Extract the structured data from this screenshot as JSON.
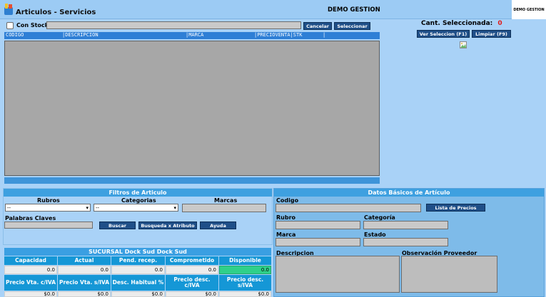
{
  "window": {
    "title": "Articulos - Servicios",
    "brand": "DEMO GESTION",
    "corner_logo_text": "DEMO GESTION"
  },
  "search": {
    "con_stock_label": "Con Stock",
    "cancel_label": "Cancelar",
    "select_label": "Seleccionar"
  },
  "selection": {
    "count_label": "Cant. Seleccionada:",
    "count_value": "0",
    "view_label": "Ver Seleccion (F1)",
    "clear_label": "Limpiar (F9)"
  },
  "table": {
    "columns": [
      "CODIGO",
      "|DESCRIPCION",
      "|MARCA",
      "|PRECIOVENTA|STK",
      "|"
    ]
  },
  "filters": {
    "title": "Filtros de Articulo",
    "rubros_label": "Rubros",
    "categorias_label": "Categorias",
    "marcas_label": "Marcas",
    "rubros_value": "--",
    "categorias_value": "--",
    "keywords_label": "Palabras Claves",
    "buscar_label": "Buscar",
    "atributo_label": "Busqueda x Atributo",
    "ayuda_label": "Ayuda"
  },
  "branch": {
    "title": "SUCURSAL Dock Sud Dock Sud",
    "row1_headers": [
      "Capacidad",
      "Actual",
      "Pend. recep.",
      "Comprometido",
      "Disponible"
    ],
    "row1_values": [
      "0.0",
      "0.0",
      "0.0",
      "0.0",
      "0.0"
    ],
    "row2_headers": [
      "Precio Vta. c/IVA",
      "Precio Vta. s/IVA",
      "Desc. Habitual %",
      "Precio desc. c/IVA",
      "Precio desc. s/IVA"
    ],
    "row2_values": [
      "$0.0",
      "$0.0",
      "$0.0",
      "$0.0",
      "$0.0"
    ]
  },
  "basic": {
    "title": "Datos Básicos  de  Artículo",
    "codigo_label": "Codigo",
    "lista_precios_label": "Lista de Precios",
    "rubro_label": "Rubro",
    "categoria_label": "Categoría",
    "marca_label": "Marca",
    "estado_label": "Estado",
    "descripcion_label": "Descripcion",
    "observacion_label": "Observación Proveedor"
  },
  "colors": {
    "background": "#a9d2f7",
    "button": "#1f4f88",
    "panel_header": "#3ea0e0",
    "available": "#2fd08a",
    "count_red": "#e01b1b"
  }
}
